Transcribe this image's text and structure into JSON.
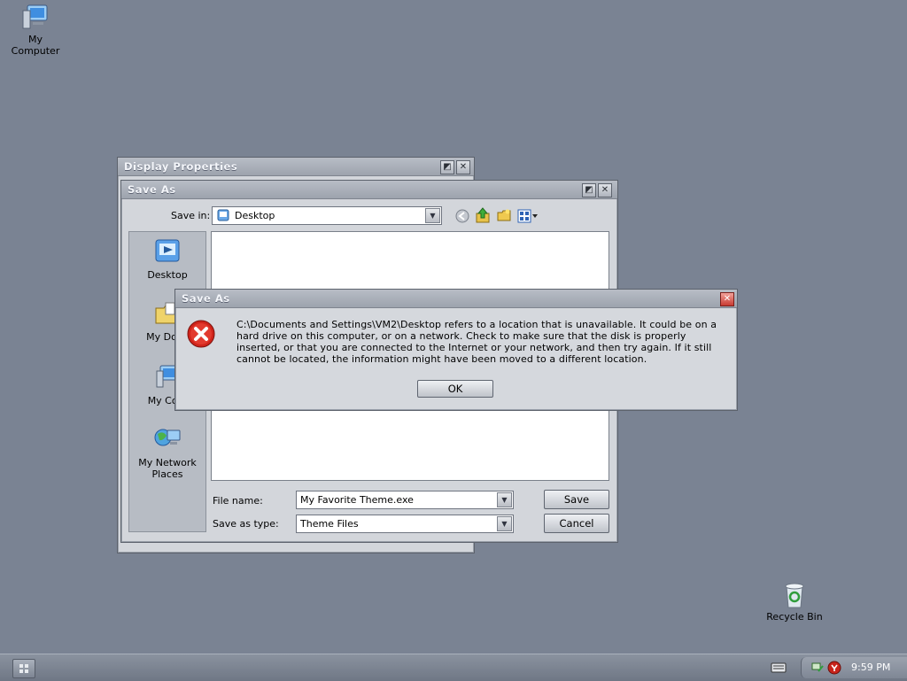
{
  "desktop": {
    "icons": [
      {
        "label": "My\nComputer",
        "name": "my-computer"
      },
      {
        "label": "Recycle Bin",
        "name": "recycle-bin"
      }
    ]
  },
  "display_properties": {
    "title": "Display Properties"
  },
  "save_as": {
    "title": "Save As",
    "save_in_label": "Save in:",
    "save_in_value": "Desktop",
    "places": [
      {
        "label": "Desktop"
      },
      {
        "label": "My Docu"
      },
      {
        "label": "My Com"
      },
      {
        "label": "My Network\nPlaces"
      }
    ],
    "file_name_label": "File name:",
    "file_name_value": "My Favorite Theme.exe",
    "save_type_label": "Save as type:",
    "save_type_value": "Theme Files",
    "save_button": "Save",
    "cancel_button": "Cancel"
  },
  "error": {
    "title": "Save As",
    "message_lines": [
      "C:\\Documents and Settings\\VM2\\Desktop refers to a location that is unavailable. It could be on a",
      "hard drive on this computer, or on a network. Check to make sure that the disk is properly",
      "inserted, or that you are connected to the Internet or your network, and then try again. If it still",
      "cannot be located, the information might have been moved to a different location."
    ],
    "ok_button": "OK"
  },
  "taskbar": {
    "clock": "9:59 PM"
  },
  "colors": {
    "desktop": "#7a8393",
    "error_icon": "#d0241b"
  }
}
